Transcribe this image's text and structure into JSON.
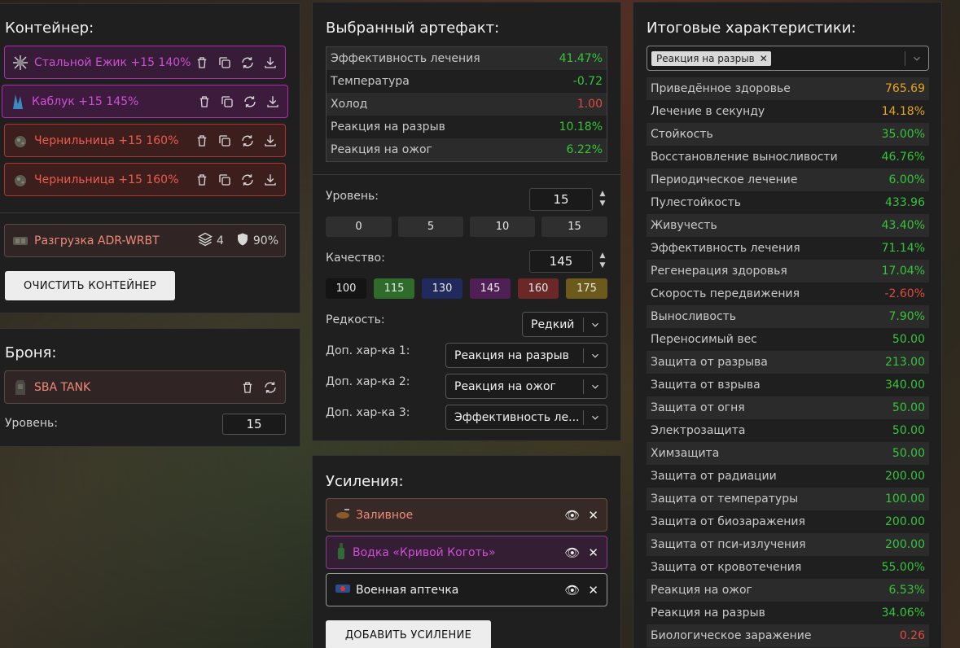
{
  "container": {
    "title": "Контейнер:",
    "artifacts": [
      {
        "name": "Стальной Ежик +15 140%"
      },
      {
        "name": "Каблук +15 145%"
      },
      {
        "name": "Чернильница +15 160%"
      },
      {
        "name": "Чернильница +15 160%"
      }
    ],
    "rig": {
      "name": "Разгрузка ADR-WRBT",
      "slots": "4",
      "protection": "90%"
    },
    "clear_button": "ОЧИСТИТЬ КОНТЕЙНЕР"
  },
  "armor": {
    "title": "Броня:",
    "name": "SBA TANK",
    "level_label": "Уровень:",
    "level_value": "15"
  },
  "artifact": {
    "title": "Выбранный артефакт:",
    "stats": [
      {
        "label": "Эффективность лечения",
        "value": "41.47%",
        "color": "green"
      },
      {
        "label": "Температура",
        "value": "-0.72",
        "color": "green"
      },
      {
        "label": "Холод",
        "value": "1.00",
        "color": "red"
      },
      {
        "label": "Реакция на разрыв",
        "value": "10.18%",
        "color": "green"
      },
      {
        "label": "Реакция на ожог",
        "value": "6.22%",
        "color": "green"
      }
    ],
    "level_label": "Уровень:",
    "level_value": "15",
    "level_presets": [
      "0",
      "5",
      "10",
      "15"
    ],
    "quality_label": "Качество:",
    "quality_value": "145",
    "quality_presets": [
      {
        "label": "100",
        "color": "#141414"
      },
      {
        "label": "115",
        "color": "#2f6b2a"
      },
      {
        "label": "130",
        "color": "#202a5c"
      },
      {
        "label": "145",
        "color": "#4f1f55"
      },
      {
        "label": "160",
        "color": "#6b2826"
      },
      {
        "label": "175",
        "color": "#6b5a1a"
      }
    ],
    "rarity_label": "Редкость:",
    "rarity_value": "Редкий",
    "extra1_label": "Доп. хар-ка 1:",
    "extra1_value": "Реакция на разрыв",
    "extra2_label": "Доп. хар-ка 2:",
    "extra2_value": "Реакция на ожог",
    "extra3_label": "Доп. хар-ка 3:",
    "extra3_value": "Эффективность ле..."
  },
  "boosts": {
    "title": "Усиления:",
    "items": [
      {
        "name": "Заливное"
      },
      {
        "name": "Водка «Кривой Коготь»"
      },
      {
        "name": "Военная аптечка"
      }
    ],
    "add_button": "ДОБАВИТЬ УСИЛЕНИЕ"
  },
  "totals": {
    "title": "Итоговые характеристики:",
    "filter_tag": "Реакция на разрыв",
    "rows": [
      {
        "label": "Приведённое здоровье",
        "value": "765.69",
        "color": "orange"
      },
      {
        "label": "Лечение в секунду",
        "value": "14.18%",
        "color": "orange"
      },
      {
        "label": "Стойкость",
        "value": "35.00%",
        "color": "green"
      },
      {
        "label": "Восстановление выносливости",
        "value": "46.76%",
        "color": "green"
      },
      {
        "label": "Периодическое лечение",
        "value": "6.00%",
        "color": "green"
      },
      {
        "label": "Пулестойкость",
        "value": "433.96",
        "color": "green"
      },
      {
        "label": "Живучесть",
        "value": "43.40%",
        "color": "green"
      },
      {
        "label": "Эффективность лечения",
        "value": "71.14%",
        "color": "green"
      },
      {
        "label": "Регенерация здоровья",
        "value": "17.04%",
        "color": "green"
      },
      {
        "label": "Скорость передвижения",
        "value": "-2.60%",
        "color": "red"
      },
      {
        "label": "Выносливость",
        "value": "7.90%",
        "color": "green"
      },
      {
        "label": "Переносимый вес",
        "value": "50.00",
        "color": "green"
      },
      {
        "label": "Защита от разрыва",
        "value": "213.00",
        "color": "green"
      },
      {
        "label": "Защита от взрыва",
        "value": "340.00",
        "color": "green"
      },
      {
        "label": "Защита от огня",
        "value": "50.00",
        "color": "green"
      },
      {
        "label": "Электрозащита",
        "value": "50.00",
        "color": "green"
      },
      {
        "label": "Химзащита",
        "value": "50.00",
        "color": "green"
      },
      {
        "label": "Защита от радиации",
        "value": "200.00",
        "color": "green"
      },
      {
        "label": "Защита от температуры",
        "value": "100.00",
        "color": "green"
      },
      {
        "label": "Защита от биозаражения",
        "value": "200.00",
        "color": "green"
      },
      {
        "label": "Защита от пси-излучения",
        "value": "200.00",
        "color": "green"
      },
      {
        "label": "Защита от кровотечения",
        "value": "55.00%",
        "color": "green"
      },
      {
        "label": "Реакция на ожог",
        "value": "6.53%",
        "color": "green"
      },
      {
        "label": "Реакция на разрыв",
        "value": "34.06%",
        "color": "green"
      },
      {
        "label": "Биологическое заражение",
        "value": "0.26",
        "color": "red"
      }
    ]
  }
}
